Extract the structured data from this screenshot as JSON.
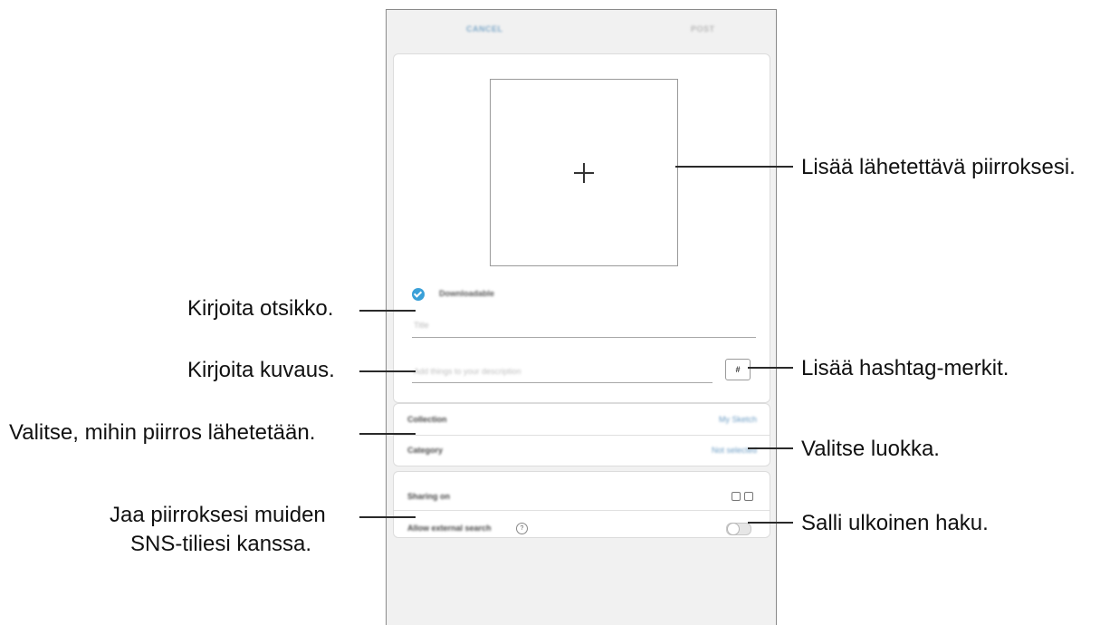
{
  "topbar": {
    "cancel_label": "CANCEL",
    "post_label": "POST"
  },
  "form": {
    "downloadable_label": "Downloadable",
    "title_placeholder": "Title",
    "description_placeholder": "Add things to your description",
    "hashtag_label": "#"
  },
  "target_rows": [
    {
      "label": "Collection",
      "value": "My Sketch"
    },
    {
      "label": "Category",
      "value": "Not selected"
    }
  ],
  "share_rows": {
    "sharing_label": "Sharing on",
    "external_search_label": "Allow external search",
    "help_symbol": "?"
  },
  "callouts": {
    "add_drawing": "Lisää lähetettävä piirroksesi.",
    "enter_title": "Kirjoita otsikko.",
    "enter_description": "Kirjoita kuvaus.",
    "add_hashtags": "Lisää hashtag-merkit.",
    "select_target": "Valitse, mihin piirros lähetetään.",
    "select_category": "Valitse luokka.",
    "share_line1": "Jaa piirroksesi muiden",
    "share_line2": "SNS-tiliesi kanssa.",
    "allow_search": "Salli ulkoinen haku."
  }
}
